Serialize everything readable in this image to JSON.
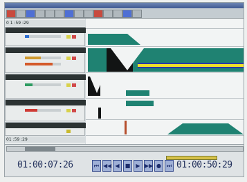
{
  "window": {
    "title": ""
  },
  "tracks": [
    {
      "label": "",
      "meter_level": 0.12,
      "accent": "#2f6fd0"
    },
    {
      "label": "",
      "meter_level": 0.45,
      "accent": "#d09a2f"
    },
    {
      "label": "",
      "meter_level": 0.78,
      "accent": "#d45a2a"
    },
    {
      "label": "",
      "meter_level": 0.22,
      "accent": "#2d9c61"
    },
    {
      "label": "",
      "meter_level": 0.35,
      "accent": "#cf3b35"
    },
    {
      "label": "",
      "meter_level": 0.3,
      "accent": "#c9ba2f"
    }
  ],
  "timecode_strip_top": "0 1 :59 :29",
  "timecode_strip_bottom": "01 :59 :29",
  "transport": {
    "current_time": "01:00:07:26",
    "end_time": "01:00:50:29",
    "buttons": [
      "⏮",
      "◀◀",
      "◀",
      "■",
      "▶",
      "▶▶",
      "●",
      "⏭"
    ]
  },
  "colors": {
    "teal": "#1f8272",
    "black": "#121414",
    "waveform_yellow": "#f0e12a",
    "waveform_blue": "#2a3aa8"
  },
  "icons": {
    "transport": [
      "skip-back-icon",
      "rewind-icon",
      "step-back-icon",
      "stop-icon",
      "play-icon",
      "fast-forward-icon",
      "record-icon",
      "skip-forward-icon"
    ]
  }
}
